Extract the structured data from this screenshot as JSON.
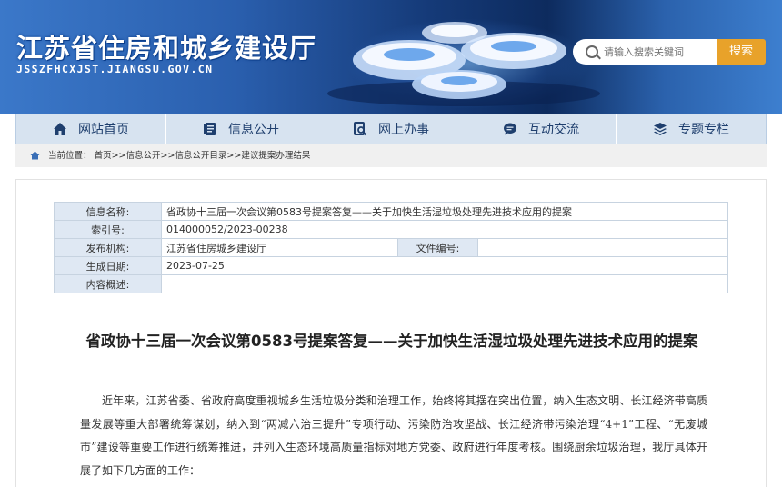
{
  "header": {
    "site_title": "江苏省住房和城乡建设厅",
    "site_domain": "JSSZFHCXJST.JIANGSU.GOV.CN",
    "search_placeholder": "请输入搜索关键词",
    "search_button": "搜索"
  },
  "nav": {
    "items": [
      {
        "label": "网站首页",
        "icon": "home-icon"
      },
      {
        "label": "信息公开",
        "icon": "document-icon"
      },
      {
        "label": "网上办事",
        "icon": "search-doc-icon"
      },
      {
        "label": "互动交流",
        "icon": "chat-icon"
      },
      {
        "label": "专题专栏",
        "icon": "layers-icon"
      }
    ]
  },
  "breadcrumb": {
    "prefix": "当前位置：",
    "path": "首页>>信息公开>>信息公开目录>>建议提案办理结果"
  },
  "meta": {
    "name_label": "信息名称:",
    "name_value": "省政协十三届一次会议第0583号提案答复——关于加快生活湿垃圾处理先进技术应用的提案",
    "index_label": "索引号:",
    "index_value": "014000052/2023-00238",
    "org_label": "发布机构:",
    "org_value": "江苏省住房城乡建设厅",
    "docno_label": "文件编号:",
    "docno_value": "",
    "date_label": "生成日期:",
    "date_value": "2023-07-25",
    "summary_label": "内容概述:",
    "summary_value": ""
  },
  "article": {
    "title": "省政协十三届一次会议第0583号提案答复——关于加快生活湿垃圾处理先进技术应用的提案",
    "paragraph": "近年来，江苏省委、省政府高度重视城乡生活垃圾分类和治理工作，始终将其摆在突出位置，纳入生态文明、长江经济带高质量发展等重大部署统筹谋划，纳入到“两减六治三提升”专项行动、污染防治攻坚战、长江经济带污染治理“4+1”工程、“无废城市”建设等重要工作进行统筹推进，并列入生态环境高质量指标对地方党委、政府进行年度考核。围绕厨余垃圾治理，我厅具体开展了如下几方面的工作："
  },
  "colors": {
    "nav_bg": "#d7e3f0",
    "nav_text": "#1f3f6e",
    "search_button": "#e8a22a",
    "table_label_bg": "#dfe8f3"
  }
}
